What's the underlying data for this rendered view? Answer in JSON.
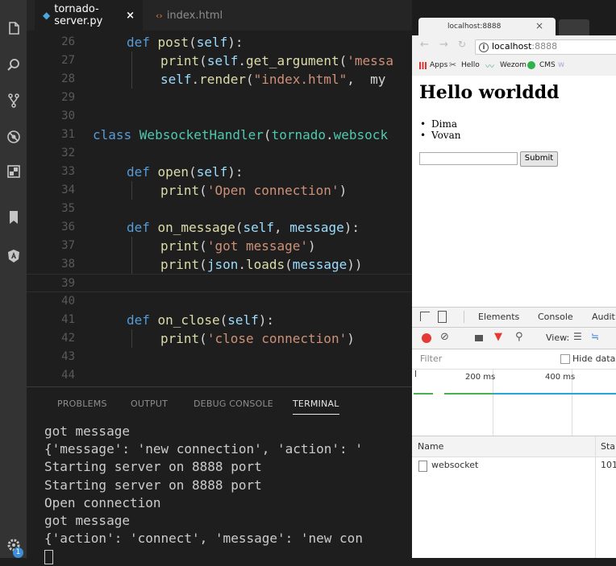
{
  "editor": {
    "tabs": [
      {
        "label": "tornado-server.py",
        "close": "×"
      },
      {
        "label": "index.html"
      }
    ],
    "lines": [
      {
        "num": "26",
        "tokens": [
          [
            "kw",
            "def "
          ],
          [
            "fn",
            "post"
          ],
          [
            "pl",
            "("
          ],
          [
            "slf",
            "self"
          ],
          [
            "pl",
            "):"
          ]
        ],
        "indent": 1
      },
      {
        "num": "27",
        "tokens": [
          [
            "fn",
            "print"
          ],
          [
            "pl",
            "("
          ],
          [
            "slf",
            "self"
          ],
          [
            "pl",
            "."
          ],
          [
            "fn",
            "get_argument"
          ],
          [
            "pl",
            "("
          ],
          [
            "str",
            "'messa"
          ]
        ],
        "indent": 2
      },
      {
        "num": "28",
        "tokens": [
          [
            "slf",
            "self"
          ],
          [
            "pl",
            "."
          ],
          [
            "fn",
            "render"
          ],
          [
            "pl",
            "("
          ],
          [
            "str",
            "\"index.html\""
          ],
          [
            "pl",
            ",  my"
          ]
        ],
        "indent": 2
      },
      {
        "num": "29",
        "tokens": [],
        "indent": 0
      },
      {
        "num": "30",
        "tokens": [],
        "indent": 0
      },
      {
        "num": "31",
        "tokens": [
          [
            "kw",
            "class "
          ],
          [
            "cls",
            "WebsocketHandler"
          ],
          [
            "pl",
            "("
          ],
          [
            "cls",
            "tornado"
          ],
          [
            "pl",
            "."
          ],
          [
            "cls",
            "websock"
          ]
        ],
        "indent": 0
      },
      {
        "num": "32",
        "tokens": [],
        "indent": 0
      },
      {
        "num": "33",
        "tokens": [
          [
            "kw",
            "def "
          ],
          [
            "fn",
            "open"
          ],
          [
            "pl",
            "("
          ],
          [
            "slf",
            "self"
          ],
          [
            "pl",
            "):"
          ]
        ],
        "indent": 1
      },
      {
        "num": "34",
        "tokens": [
          [
            "fn",
            "print"
          ],
          [
            "pl",
            "("
          ],
          [
            "str",
            "'Open connection'"
          ],
          [
            "pl",
            ")"
          ]
        ],
        "indent": 2
      },
      {
        "num": "35",
        "tokens": [],
        "indent": 0
      },
      {
        "num": "36",
        "tokens": [
          [
            "kw",
            "def "
          ],
          [
            "fn",
            "on_message"
          ],
          [
            "pl",
            "("
          ],
          [
            "slf",
            "self"
          ],
          [
            "pl",
            ", "
          ],
          [
            "slf",
            "message"
          ],
          [
            "pl",
            "):"
          ]
        ],
        "indent": 1
      },
      {
        "num": "37",
        "tokens": [
          [
            "fn",
            "print"
          ],
          [
            "pl",
            "("
          ],
          [
            "str",
            "'got message'"
          ],
          [
            "pl",
            ")"
          ]
        ],
        "indent": 2
      },
      {
        "num": "38",
        "tokens": [
          [
            "fn",
            "print"
          ],
          [
            "pl",
            "("
          ],
          [
            "slf",
            "json"
          ],
          [
            "pl",
            "."
          ],
          [
            "fn",
            "loads"
          ],
          [
            "pl",
            "("
          ],
          [
            "slf",
            "message"
          ],
          [
            "pl",
            "))"
          ]
        ],
        "indent": 2
      },
      {
        "num": "39",
        "tokens": [],
        "indent": 0,
        "current": true
      },
      {
        "num": "40",
        "tokens": [],
        "indent": 0
      },
      {
        "num": "41",
        "tokens": [
          [
            "kw",
            "def "
          ],
          [
            "fn",
            "on_close"
          ],
          [
            "pl",
            "("
          ],
          [
            "slf",
            "self"
          ],
          [
            "pl",
            "):"
          ]
        ],
        "indent": 1
      },
      {
        "num": "42",
        "tokens": [
          [
            "fn",
            "print"
          ],
          [
            "pl",
            "("
          ],
          [
            "str",
            "'close connection'"
          ],
          [
            "pl",
            ")"
          ]
        ],
        "indent": 2
      },
      {
        "num": "43",
        "tokens": [],
        "indent": 0
      },
      {
        "num": "44",
        "tokens": [],
        "indent": 0
      }
    ]
  },
  "panel": {
    "tabs": [
      "PROBLEMS",
      "OUTPUT",
      "DEBUG CONSOLE",
      "TERMINAL"
    ],
    "active_tab": "TERMINAL",
    "terminal_lines": [
      "got message",
      "{'message': 'new connection', 'action': '",
      "Starting server on 8888 port",
      "Starting server on 8888 port",
      "Open connection",
      "got message",
      "{'action': 'connect', 'message': 'new con"
    ]
  },
  "activity_bar": {
    "icons": [
      "files-icon",
      "search-icon",
      "source-control-icon",
      "debug-icon",
      "extensions-icon",
      "bookmark-icon",
      "angular-icon"
    ],
    "settings_badge": "1"
  },
  "browser": {
    "tab_title": "localhost:8888",
    "tab_close": "×",
    "url_host": "localhost",
    "url_port": ":8888",
    "bookmarks": [
      "Apps",
      "Hello",
      "Wezom",
      "CMS"
    ],
    "page": {
      "heading": "Hello worlddd",
      "list": [
        "Dima",
        "Vovan"
      ],
      "input_value": "",
      "submit_label": "Submit"
    },
    "devtools": {
      "tabs": [
        "Elements",
        "Console",
        "Audit"
      ],
      "view_label": "View:",
      "filter_placeholder": "Filter",
      "hide_data_label": "Hide data",
      "timeline_ticks": [
        "200 ms",
        "400 ms"
      ],
      "columns": [
        "Name",
        "Sta"
      ],
      "requests": [
        {
          "name": "websocket",
          "status": "101"
        }
      ]
    }
  },
  "colors": {
    "keyword": "#569cd6",
    "function": "#dcdcaa",
    "string": "#ce9178",
    "class": "#4ec9b0",
    "record_red": "#e53935",
    "timeline_green": "#4caf50",
    "timeline_blue": "#26a6d6"
  }
}
